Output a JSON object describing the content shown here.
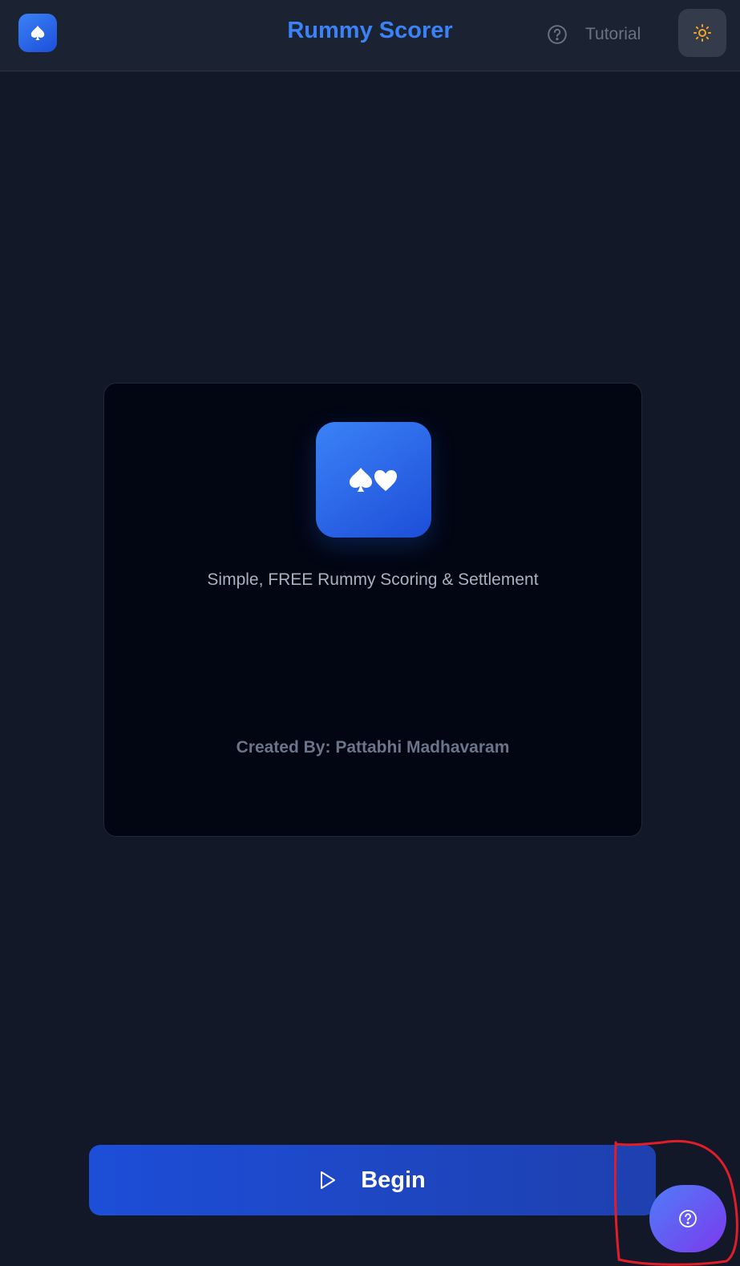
{
  "header": {
    "logo_icon": "spade-icon",
    "title": "Rummy Scorer",
    "tutorial_label": "Tutorial",
    "tutorial_icon": "help-circle-icon",
    "theme_icon": "sun-icon"
  },
  "card": {
    "icon": "spade-heart-icon",
    "tagline": "Simple, FREE Rummy Scoring & Settlement",
    "credit": "Created By: Pattabhi Madhavaram"
  },
  "actions": {
    "begin_label": "Begin",
    "begin_icon": "play-icon",
    "help_icon": "help-circle-icon"
  },
  "colors": {
    "background": "#121827",
    "header_bg": "#1b2232",
    "accent": "#3b82f6",
    "sun": "#f5a524",
    "annotation": "#e11d2a"
  }
}
